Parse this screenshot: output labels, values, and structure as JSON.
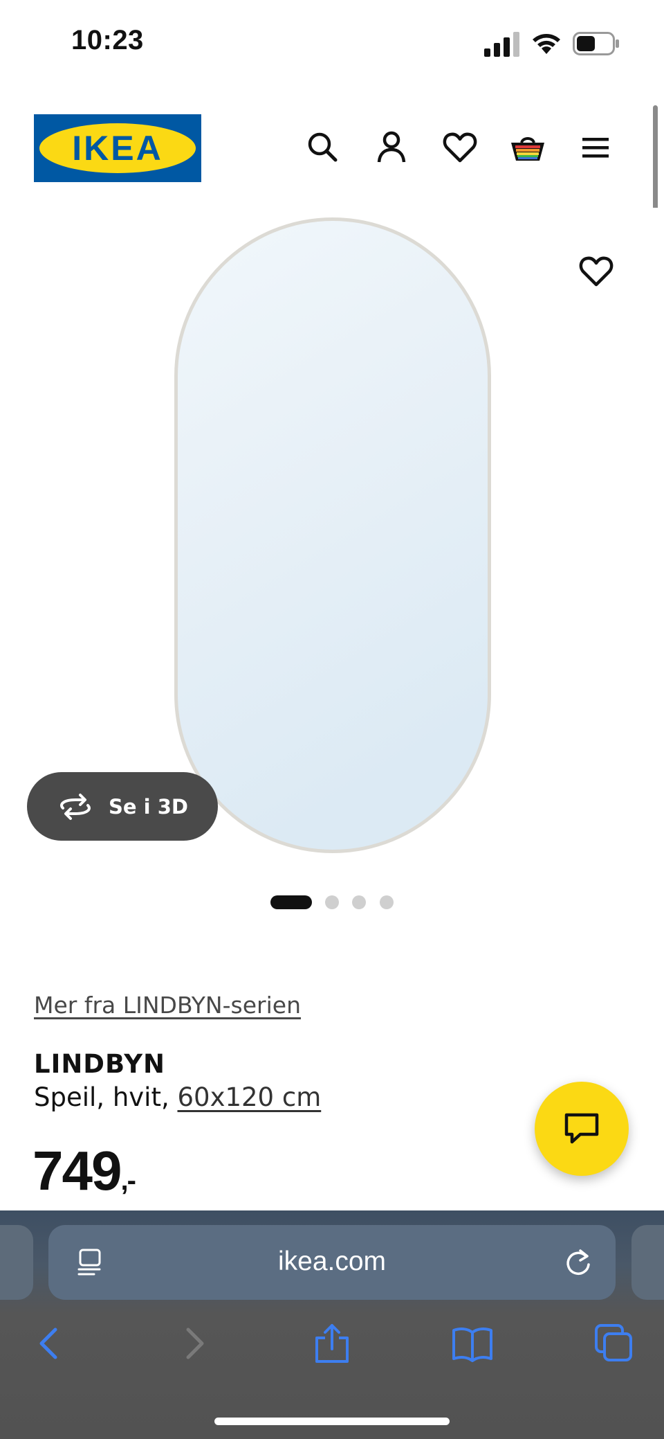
{
  "status_bar": {
    "time": "10:23"
  },
  "header": {
    "logo_text": "IKEA",
    "icons": [
      "search-icon",
      "account-icon",
      "favourites-icon",
      "cart-icon",
      "menu-icon"
    ]
  },
  "gallery": {
    "view_3d_label": "Se i 3D",
    "slide_count": 4,
    "active_slide": 1
  },
  "product": {
    "series_link": "Mer fra LINDBYN-serien",
    "name": "LINDBYN",
    "description": "Speil, hvit, ",
    "size": "60x120 cm",
    "price": "749",
    "price_suffix": ",-"
  },
  "browser": {
    "url": "ikea.com",
    "toolbar": [
      "back-icon",
      "forward-icon",
      "share-icon",
      "bookmarks-icon",
      "tabs-icon"
    ]
  },
  "colors": {
    "ikea_blue": "#0058a3",
    "ikea_yellow": "#fbd914",
    "safari_accent": "#3d7ef0"
  }
}
